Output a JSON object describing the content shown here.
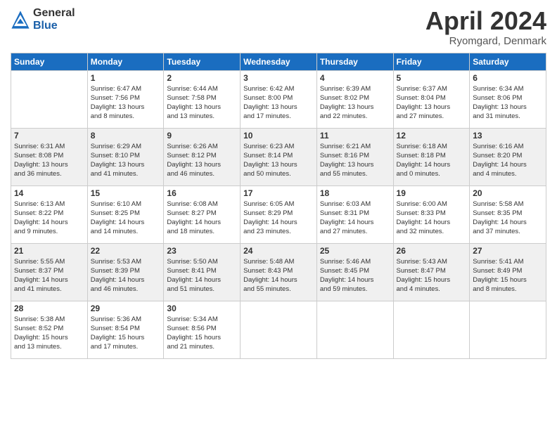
{
  "logo": {
    "general": "General",
    "blue": "Blue"
  },
  "title": "April 2024",
  "location": "Ryomgard, Denmark",
  "weekdays": [
    "Sunday",
    "Monday",
    "Tuesday",
    "Wednesday",
    "Thursday",
    "Friday",
    "Saturday"
  ],
  "weeks": [
    [
      {
        "day": "",
        "info": ""
      },
      {
        "day": "1",
        "info": "Sunrise: 6:47 AM\nSunset: 7:56 PM\nDaylight: 13 hours\nand 8 minutes."
      },
      {
        "day": "2",
        "info": "Sunrise: 6:44 AM\nSunset: 7:58 PM\nDaylight: 13 hours\nand 13 minutes."
      },
      {
        "day": "3",
        "info": "Sunrise: 6:42 AM\nSunset: 8:00 PM\nDaylight: 13 hours\nand 17 minutes."
      },
      {
        "day": "4",
        "info": "Sunrise: 6:39 AM\nSunset: 8:02 PM\nDaylight: 13 hours\nand 22 minutes."
      },
      {
        "day": "5",
        "info": "Sunrise: 6:37 AM\nSunset: 8:04 PM\nDaylight: 13 hours\nand 27 minutes."
      },
      {
        "day": "6",
        "info": "Sunrise: 6:34 AM\nSunset: 8:06 PM\nDaylight: 13 hours\nand 31 minutes."
      }
    ],
    [
      {
        "day": "7",
        "info": "Sunrise: 6:31 AM\nSunset: 8:08 PM\nDaylight: 13 hours\nand 36 minutes."
      },
      {
        "day": "8",
        "info": "Sunrise: 6:29 AM\nSunset: 8:10 PM\nDaylight: 13 hours\nand 41 minutes."
      },
      {
        "day": "9",
        "info": "Sunrise: 6:26 AM\nSunset: 8:12 PM\nDaylight: 13 hours\nand 46 minutes."
      },
      {
        "day": "10",
        "info": "Sunrise: 6:23 AM\nSunset: 8:14 PM\nDaylight: 13 hours\nand 50 minutes."
      },
      {
        "day": "11",
        "info": "Sunrise: 6:21 AM\nSunset: 8:16 PM\nDaylight: 13 hours\nand 55 minutes."
      },
      {
        "day": "12",
        "info": "Sunrise: 6:18 AM\nSunset: 8:18 PM\nDaylight: 14 hours\nand 0 minutes."
      },
      {
        "day": "13",
        "info": "Sunrise: 6:16 AM\nSunset: 8:20 PM\nDaylight: 14 hours\nand 4 minutes."
      }
    ],
    [
      {
        "day": "14",
        "info": "Sunrise: 6:13 AM\nSunset: 8:22 PM\nDaylight: 14 hours\nand 9 minutes."
      },
      {
        "day": "15",
        "info": "Sunrise: 6:10 AM\nSunset: 8:25 PM\nDaylight: 14 hours\nand 14 minutes."
      },
      {
        "day": "16",
        "info": "Sunrise: 6:08 AM\nSunset: 8:27 PM\nDaylight: 14 hours\nand 18 minutes."
      },
      {
        "day": "17",
        "info": "Sunrise: 6:05 AM\nSunset: 8:29 PM\nDaylight: 14 hours\nand 23 minutes."
      },
      {
        "day": "18",
        "info": "Sunrise: 6:03 AM\nSunset: 8:31 PM\nDaylight: 14 hours\nand 27 minutes."
      },
      {
        "day": "19",
        "info": "Sunrise: 6:00 AM\nSunset: 8:33 PM\nDaylight: 14 hours\nand 32 minutes."
      },
      {
        "day": "20",
        "info": "Sunrise: 5:58 AM\nSunset: 8:35 PM\nDaylight: 14 hours\nand 37 minutes."
      }
    ],
    [
      {
        "day": "21",
        "info": "Sunrise: 5:55 AM\nSunset: 8:37 PM\nDaylight: 14 hours\nand 41 minutes."
      },
      {
        "day": "22",
        "info": "Sunrise: 5:53 AM\nSunset: 8:39 PM\nDaylight: 14 hours\nand 46 minutes."
      },
      {
        "day": "23",
        "info": "Sunrise: 5:50 AM\nSunset: 8:41 PM\nDaylight: 14 hours\nand 51 minutes."
      },
      {
        "day": "24",
        "info": "Sunrise: 5:48 AM\nSunset: 8:43 PM\nDaylight: 14 hours\nand 55 minutes."
      },
      {
        "day": "25",
        "info": "Sunrise: 5:46 AM\nSunset: 8:45 PM\nDaylight: 14 hours\nand 59 minutes."
      },
      {
        "day": "26",
        "info": "Sunrise: 5:43 AM\nSunset: 8:47 PM\nDaylight: 15 hours\nand 4 minutes."
      },
      {
        "day": "27",
        "info": "Sunrise: 5:41 AM\nSunset: 8:49 PM\nDaylight: 15 hours\nand 8 minutes."
      }
    ],
    [
      {
        "day": "28",
        "info": "Sunrise: 5:38 AM\nSunset: 8:52 PM\nDaylight: 15 hours\nand 13 minutes."
      },
      {
        "day": "29",
        "info": "Sunrise: 5:36 AM\nSunset: 8:54 PM\nDaylight: 15 hours\nand 17 minutes."
      },
      {
        "day": "30",
        "info": "Sunrise: 5:34 AM\nSunset: 8:56 PM\nDaylight: 15 hours\nand 21 minutes."
      },
      {
        "day": "",
        "info": ""
      },
      {
        "day": "",
        "info": ""
      },
      {
        "day": "",
        "info": ""
      },
      {
        "day": "",
        "info": ""
      }
    ]
  ]
}
